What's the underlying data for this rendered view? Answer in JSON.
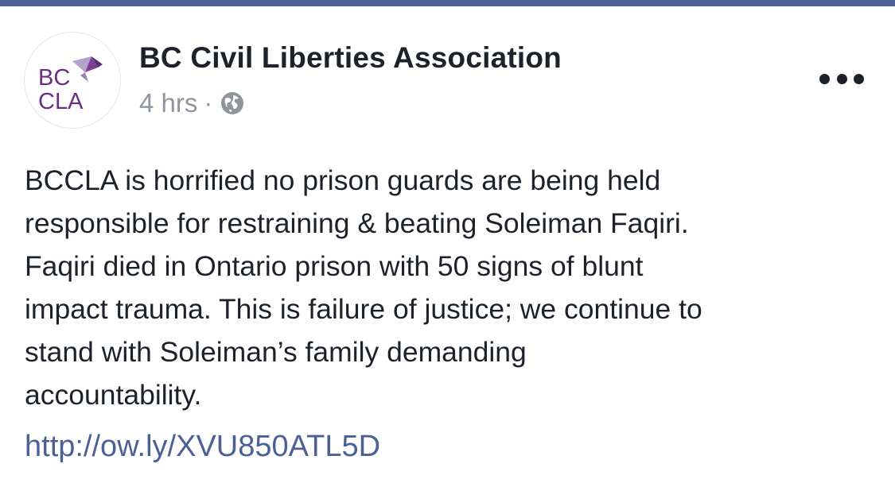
{
  "post": {
    "page_name": "BC Civil Liberties Association",
    "avatar": {
      "logo_text_top": "BC",
      "logo_text_bottom": "CLA",
      "icon": "bird-origami-logo-icon",
      "colors": {
        "text": "#6b2c85",
        "bird_dark": "#7a3d93",
        "bird_light": "#b3a2c9"
      }
    },
    "timestamp": "4 hrs",
    "separator": "·",
    "privacy_icon": "globe-icon",
    "more_icon": "ellipsis-icon",
    "text_lines": [
      "BCCLA is horrified no prison guards are being held",
      "responsible for restraining & beating Soleiman Faqiri.",
      "Faqiri died in Ontario prison with 50 signs of blunt",
      "impact trauma. This is failure of justice; we continue to",
      "stand with Soleiman’s family demanding",
      "accountability."
    ],
    "link": "http://ow.ly/XVU850ATL5D"
  },
  "colors": {
    "header_bar": "#4b6096",
    "text": "#1d2129",
    "meta": "#90949c",
    "link": "#4b6096"
  }
}
